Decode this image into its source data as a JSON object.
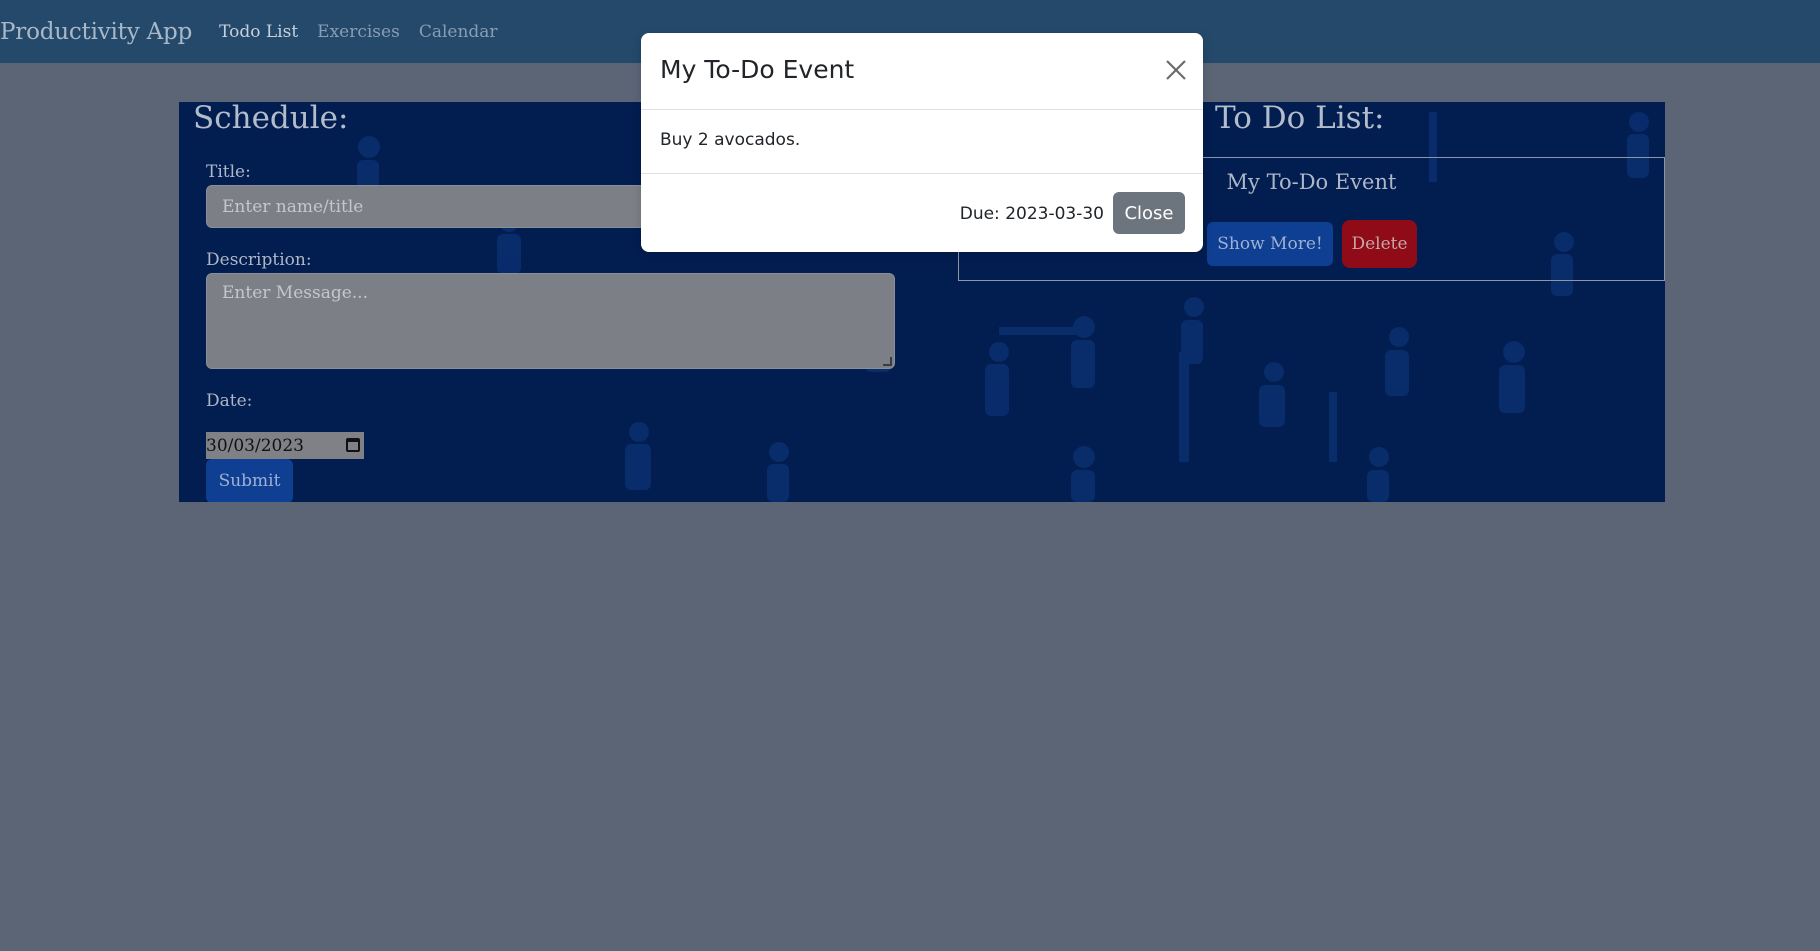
{
  "navbar": {
    "brand": "Productivity App",
    "links": [
      {
        "label": "Todo List",
        "active": true
      },
      {
        "label": "Exercises",
        "active": false
      },
      {
        "label": "Calendar",
        "active": false
      }
    ]
  },
  "schedule": {
    "heading": "Schedule:",
    "title_label": "Title:",
    "title_placeholder": "Enter name/title",
    "description_label": "Description:",
    "description_placeholder": "Enter Message...",
    "date_label": "Date:",
    "date_value": "30/03/2023",
    "submit_label": "Submit"
  },
  "todo_list": {
    "heading": "To Do List:",
    "items": [
      {
        "title": "My To-Do Event",
        "show_more_label": "Show More!",
        "delete_label": "Delete"
      }
    ]
  },
  "modal": {
    "title": "My To-Do Event",
    "body": "Buy 2 avocados.",
    "due": "Due: 2023-03-30",
    "close_label": "Close"
  },
  "colors": {
    "backdrop": "#5b6576",
    "navbar": "#24496a",
    "panel": "#021d4f",
    "primary": "#0e3f93",
    "danger": "#8f0b17",
    "secondary": "#6c757d"
  }
}
